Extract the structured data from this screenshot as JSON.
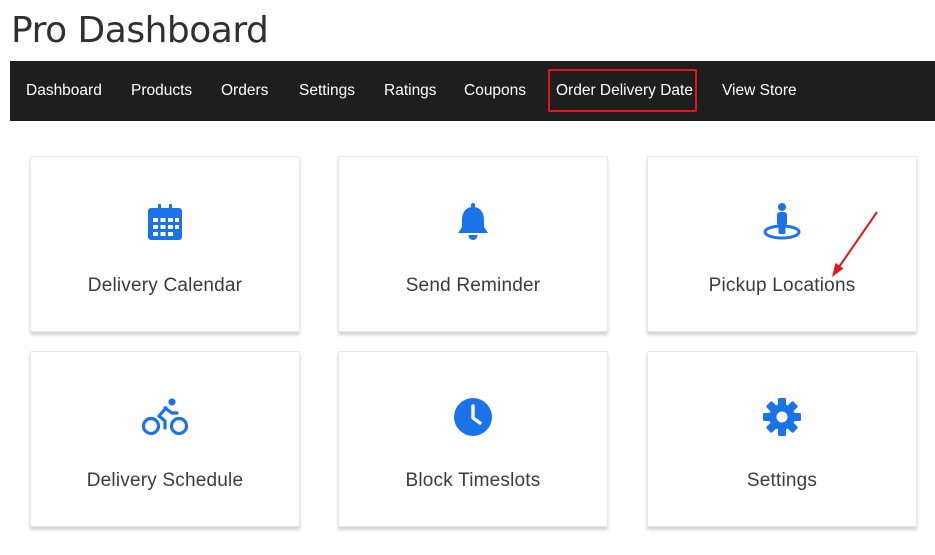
{
  "page": {
    "title": "Pro Dashboard"
  },
  "nav": {
    "items": [
      {
        "label": "Dashboard"
      },
      {
        "label": "Products"
      },
      {
        "label": "Orders"
      },
      {
        "label": "Settings"
      },
      {
        "label": "Ratings"
      },
      {
        "label": "Coupons"
      },
      {
        "label": "Order Delivery Date"
      },
      {
        "label": "View Store"
      }
    ],
    "highlighted_item": "Order Delivery Date"
  },
  "cards": [
    {
      "label": "Delivery Calendar",
      "icon": "calendar-icon"
    },
    {
      "label": "Send Reminder",
      "icon": "bell-icon"
    },
    {
      "label": "Pickup Locations",
      "icon": "person-location-icon"
    },
    {
      "label": "Delivery Schedule",
      "icon": "bicycle-icon"
    },
    {
      "label": "Block Timeslots",
      "icon": "clock-icon"
    },
    {
      "label": "Settings",
      "icon": "gear-icon"
    }
  ],
  "colors": {
    "navbar_bg": "#1e1e1e",
    "nav_text": "#ffffff",
    "accent_blue": "#1a73e8",
    "highlight_red": "#e3171a",
    "card_text": "#3b3b3b"
  }
}
